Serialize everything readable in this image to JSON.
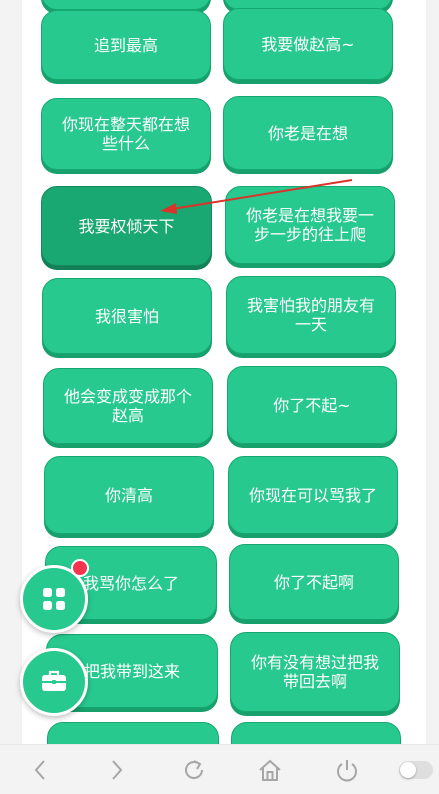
{
  "phrases": [
    {
      "label": "追到最高"
    },
    {
      "label": "我要做赵高~"
    },
    {
      "label": "你现在整天都在想些什么"
    },
    {
      "label": "你老是在想"
    },
    {
      "label": "我要权倾天下"
    },
    {
      "label": "你老是在想我要一步一步的往上爬"
    },
    {
      "label": "我很害怕"
    },
    {
      "label": "我害怕我的朋友有一天"
    },
    {
      "label": "他会变成变成那个赵高"
    },
    {
      "label": "你了不起~"
    },
    {
      "label": "你清高"
    },
    {
      "label": "你现在可以骂我了"
    },
    {
      "label": "我骂你怎么了"
    },
    {
      "label": "你了不起啊"
    },
    {
      "label": "把我带到这来"
    },
    {
      "label": "你有没有想过把我带回去啊"
    }
  ],
  "colors": {
    "accent": "#27c98f",
    "accent_dark": "#1aa872",
    "badge": "#f5344d",
    "arrow": "#d9342b"
  },
  "icons": {
    "fab_top": "grid-icon",
    "fab_bottom": "toolbox-icon",
    "nav": [
      "back-icon",
      "forward-icon",
      "refresh-icon",
      "home-icon",
      "power-icon",
      "toggle-switch"
    ]
  }
}
